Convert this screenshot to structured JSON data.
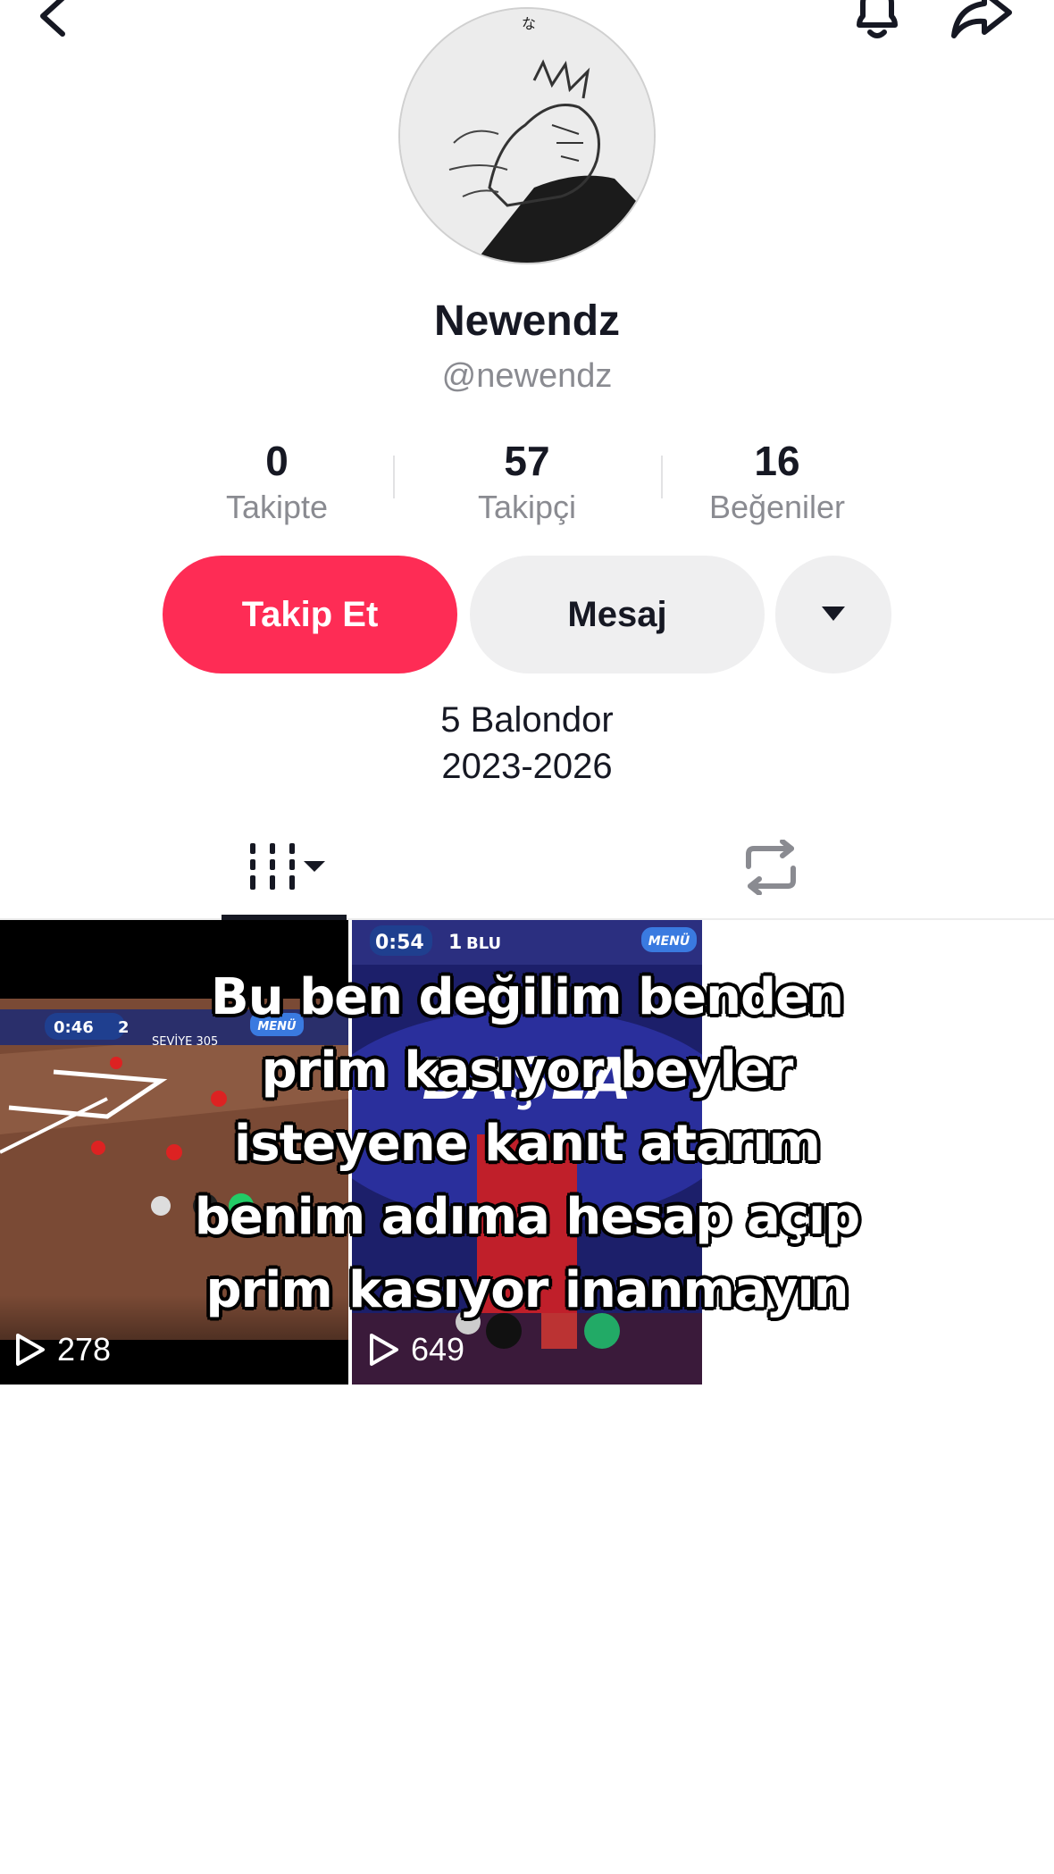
{
  "header": {
    "back_icon": "chevron-left-icon",
    "notification_icon": "bell-icon",
    "share_icon": "share-arrow-icon"
  },
  "profile": {
    "display_name": "Newendz",
    "username": "@newendz"
  },
  "stats": {
    "following": {
      "value": "0",
      "label": "Takipte"
    },
    "followers": {
      "value": "57",
      "label": "Takipçi"
    },
    "likes": {
      "value": "16",
      "label": "Beğeniler"
    }
  },
  "actions": {
    "follow_label": "Takip Et",
    "message_label": "Mesaj",
    "more_icon": "caret-down-icon"
  },
  "bio": {
    "line1": "5 Balondor",
    "line2": "2023-2026"
  },
  "tabs": {
    "videos_icon": "grid-icon",
    "reposts_icon": "repost-icon"
  },
  "videos": [
    {
      "views": "278",
      "hud_time": "0:46",
      "hud_score": "2",
      "hud_menu": "MENÜ",
      "hud_level": "SEVİYE 305"
    },
    {
      "views": "649",
      "hud_time": "0:54",
      "hud_score": "1",
      "hud_team": "BLU",
      "hud_menu": "MENÜ",
      "banner": "BAŞLA"
    }
  ],
  "overlay_caption": {
    "line1": "Bu ben değilim benden",
    "line2": "prim kasıyor beyler",
    "line3": "isteyene kanıt atarım",
    "line4": "benim adıma hesap açıp",
    "line5": "prim kasıyor inanmayın"
  },
  "colors": {
    "primary": "#fe2c55",
    "text": "#161823",
    "secondary_text": "#8a8b91",
    "button_bg": "#efeff0"
  }
}
